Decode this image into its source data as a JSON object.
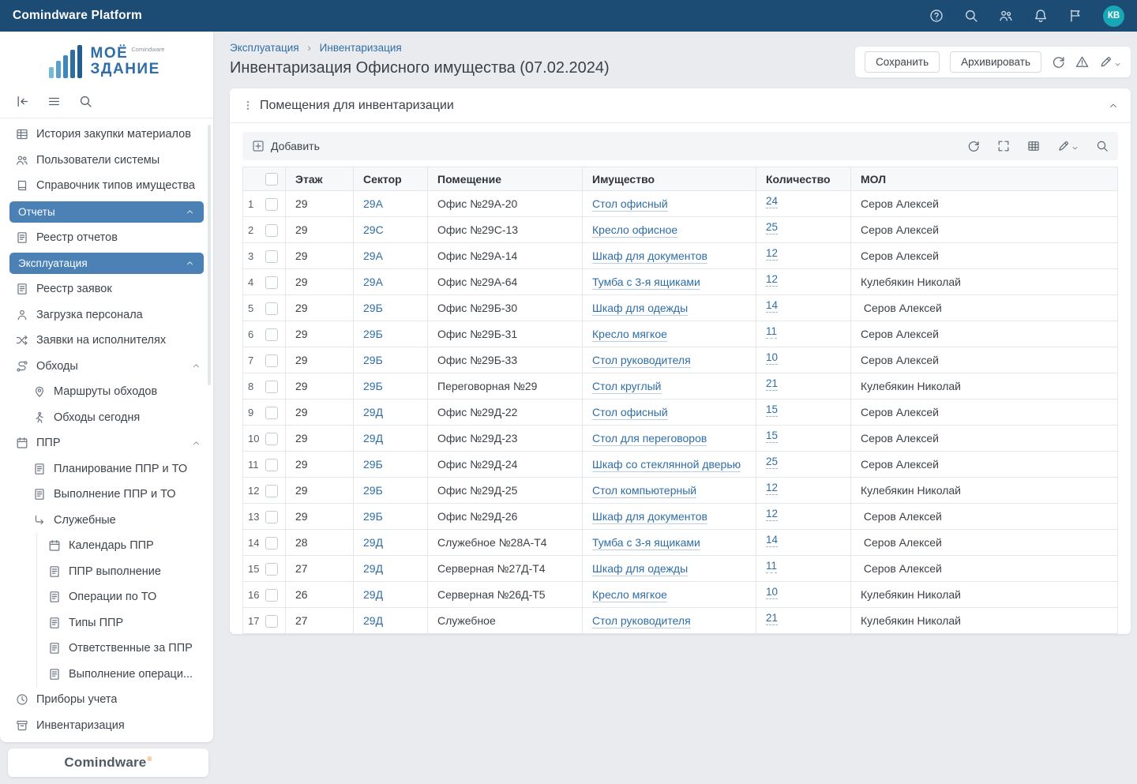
{
  "colors": {
    "topbar": "#1c4b73",
    "accent_link": "#2f6ea5",
    "section_pill": "#4b81b5",
    "avatar": "#18a7b7",
    "page_background": "#e9ebee"
  },
  "topbar": {
    "title": "Comindware Platform",
    "avatar_initials": "КВ"
  },
  "sidebar": {
    "logo": {
      "line1": "МОЁ",
      "line2": "ЗДАНИЕ",
      "brand": "Comindware"
    },
    "footer_brand": "Comindware",
    "footer_reg": "®",
    "items": [
      {
        "type": "item",
        "icon": "grid",
        "label": "История закупки материалов"
      },
      {
        "type": "item",
        "icon": "users",
        "label": "Пользователи системы"
      },
      {
        "type": "item",
        "icon": "book",
        "label": "Справочник типов имущества"
      },
      {
        "type": "section",
        "label": "Отчеты"
      },
      {
        "type": "item",
        "icon": "doc",
        "label": "Реестр отчетов"
      },
      {
        "type": "section",
        "label": "Эксплуатация"
      },
      {
        "type": "item",
        "icon": "doc",
        "label": "Реестр заявок"
      },
      {
        "type": "item",
        "icon": "person",
        "label": "Загрузка персонала"
      },
      {
        "type": "item",
        "icon": "shuffle",
        "label": "Заявки на исполнителях"
      },
      {
        "type": "group",
        "icon": "route",
        "label": "Обходы"
      },
      {
        "type": "sub1",
        "icon": "pin",
        "label": "Маршруты обходов"
      },
      {
        "type": "sub1",
        "icon": "walk",
        "label": "Обходы сегодня"
      },
      {
        "type": "group",
        "icon": "calendar",
        "label": "ППР"
      },
      {
        "type": "sub1",
        "icon": "doc",
        "label": "Планирование ППР и ТО"
      },
      {
        "type": "sub1",
        "icon": "doc",
        "label": "Выполнение ППР и ТО"
      },
      {
        "type": "sub1",
        "icon": "turn",
        "label": "Служебные"
      },
      {
        "type": "sub2",
        "icon": "calendar",
        "label": "Календарь ППР"
      },
      {
        "type": "sub2",
        "icon": "doc",
        "label": "ППР выполнение"
      },
      {
        "type": "sub2",
        "icon": "doc",
        "label": "Операции по ТО"
      },
      {
        "type": "sub2",
        "icon": "doc",
        "label": "Типы ППР"
      },
      {
        "type": "sub2",
        "icon": "doc",
        "label": "Ответственные за ППР"
      },
      {
        "type": "sub2",
        "icon": "doc",
        "label": "Выполнение операци..."
      },
      {
        "type": "item",
        "icon": "clock",
        "label": "Приборы учета"
      },
      {
        "type": "item",
        "icon": "inventory",
        "label": "Инвентаризация"
      }
    ]
  },
  "header": {
    "breadcrumb": [
      "Эксплуатация",
      "Инвентаризация"
    ],
    "breadcrumb_sep": "›",
    "title": "Инвентаризация Офисного имущества (07.02.2024)",
    "save_label": "Сохранить",
    "archive_label": "Архивировать"
  },
  "panel": {
    "title": "Помещения для инвентаризации",
    "add_label": "Добавить",
    "table": {
      "columns": [
        "Этаж",
        "Сектор",
        "Помещение",
        "Имущество",
        "Количество",
        "МОЛ"
      ],
      "rows": [
        {
          "n": "1",
          "floor": "29",
          "sector": "29А",
          "room": "Офис №29А-20",
          "asset": "Стол офисный",
          "qty": "24",
          "mol": "Серов Алексей"
        },
        {
          "n": "2",
          "floor": "29",
          "sector": "29С",
          "room": "Офис №29С-13",
          "asset": "Кресло офисное",
          "qty": "25",
          "mol": "Серов Алексей"
        },
        {
          "n": "3",
          "floor": "29",
          "sector": "29А",
          "room": "Офис №29А-14",
          "asset": "Шкаф для документов",
          "qty": "12",
          "mol": "Серов Алексей"
        },
        {
          "n": "4",
          "floor": "29",
          "sector": "29А",
          "room": "Офис №29А-64",
          "asset": "Тумба с 3-я ящиками",
          "qty": "12",
          "mol": "Кулебякин Николай"
        },
        {
          "n": "5",
          "floor": "29",
          "sector": "29Б",
          "room": "Офис №29Б-30",
          "asset": "Шкаф для одежды",
          "qty": "14",
          "mol": " Серов Алексей"
        },
        {
          "n": "6",
          "floor": "29",
          "sector": "29Б",
          "room": "Офис №29Б-31",
          "asset": "Кресло мягкое",
          "qty": "11",
          "mol": "Серов Алексей"
        },
        {
          "n": "7",
          "floor": "29",
          "sector": "29Б",
          "room": "Офис №29Б-33",
          "asset": "Стол руководителя",
          "qty": "10",
          "mol": "Серов Алексей"
        },
        {
          "n": "8",
          "floor": "29",
          "sector": "29Б",
          "room": "Переговорная №29",
          "asset": "Стол круглый",
          "qty": "21",
          "mol": "Кулебякин Николай"
        },
        {
          "n": "9",
          "floor": "29",
          "sector": "29Д",
          "room": "Офис №29Д-22",
          "asset": "Стол офисный",
          "qty": "15",
          "mol": "Серов Алексей"
        },
        {
          "n": "10",
          "floor": "29",
          "sector": "29Д",
          "room": "Офис №29Д-23",
          "asset": "Стол для переговоров",
          "qty": "15",
          "mol": "Серов Алексей"
        },
        {
          "n": "11",
          "floor": "29",
          "sector": "29Б",
          "room": "Офис №29Д-24",
          "asset": "Шкаф со стеклянной дверью",
          "qty": "25",
          "mol": "Серов Алексей"
        },
        {
          "n": "12",
          "floor": "29",
          "sector": "29Б",
          "room": "Офис №29Д-25",
          "asset": "Стол компьютерный",
          "qty": "12",
          "mol": "Кулебякин Николай"
        },
        {
          "n": "13",
          "floor": "29",
          "sector": "29Б",
          "room": "Офис №29Д-26",
          "asset": "Шкаф для документов",
          "qty": "12",
          "mol": " Серов Алексей"
        },
        {
          "n": "14",
          "floor": "28",
          "sector": "29Д",
          "room": "Служебное №28А-Т4",
          "asset": "Тумба с 3-я ящиками",
          "qty": "14",
          "mol": " Серов Алексей"
        },
        {
          "n": "15",
          "floor": "27",
          "sector": "29Д",
          "room": "Серверная №27Д-Т4",
          "asset": "Шкаф для одежды",
          "qty": "11",
          "mol": " Серов Алексей"
        },
        {
          "n": "16",
          "floor": "26",
          "sector": "29Д",
          "room": "Серверная №26Д-Т5",
          "asset": "Кресло мягкое",
          "qty": "10",
          "mol": "Кулебякин Николай"
        },
        {
          "n": "17",
          "floor": "27",
          "sector": "29Д",
          "room": "Служебное",
          "asset": "Стол руководителя",
          "qty": "21",
          "mol": "Кулебякин Николай"
        }
      ]
    }
  }
}
